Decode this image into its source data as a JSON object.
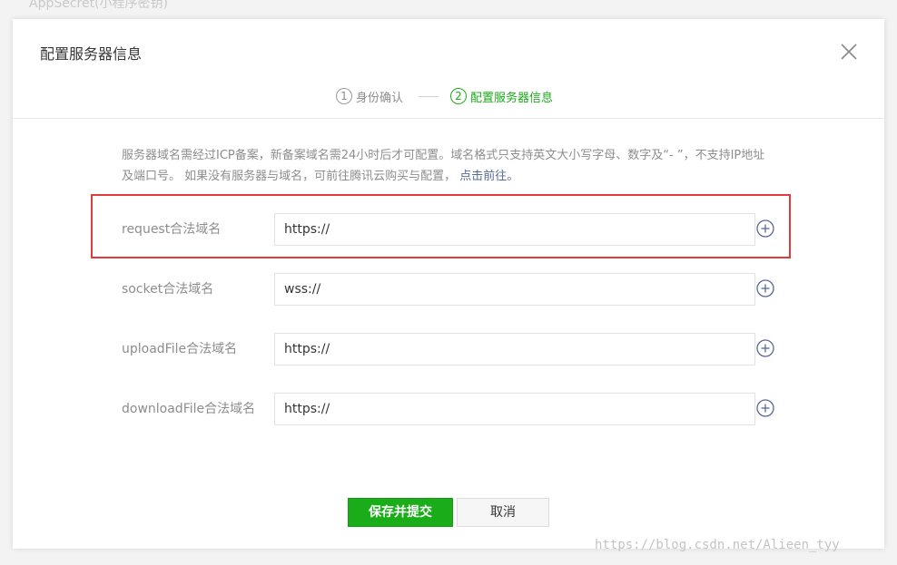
{
  "background": {
    "text": "AppSecret(小程序密钥)"
  },
  "dialog": {
    "title": "配置服务器信息",
    "close_icon": "close-icon",
    "steps": [
      {
        "num": "1",
        "label": "身份确认",
        "state": "done"
      },
      {
        "num": "2",
        "label": "配置服务器信息",
        "state": "active"
      }
    ],
    "notice": {
      "text": "服务器域名需经过ICP备案，新备案域名需24小时后才可配置。域名格式只支持英文大小写字母、数字及“- ”，不支持IP地址及端口号。 如果没有服务器与域名，可前往腾讯云购买与配置，",
      "link": "点击前往。"
    },
    "fields": [
      {
        "label": "request合法域名",
        "value": "https://",
        "add_icon": "plus-circle-icon"
      },
      {
        "label": "socket合法域名",
        "value": "wss://",
        "add_icon": "plus-circle-icon"
      },
      {
        "label": "uploadFile合法域名",
        "value": "https://",
        "add_icon": "plus-circle-icon"
      },
      {
        "label": "downloadFile合法域名",
        "value": "https://",
        "add_icon": "plus-circle-icon"
      }
    ],
    "buttons": {
      "save": "保存并提交",
      "cancel": "取消"
    }
  },
  "watermark": "https://blog.csdn.net/Alieen_tyy",
  "colors": {
    "accent": "#1aad19",
    "link": "#576b95",
    "highlight": "#e13b3b"
  }
}
